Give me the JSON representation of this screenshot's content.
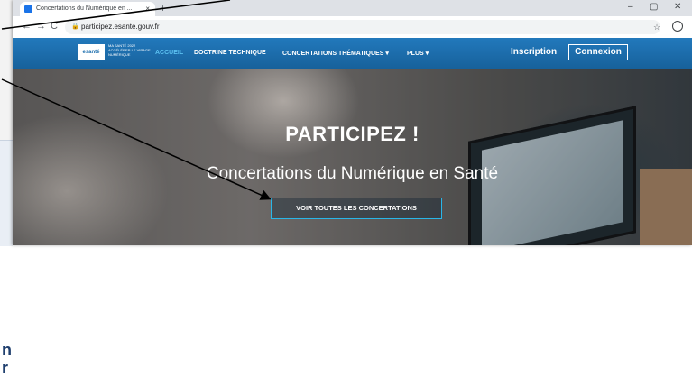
{
  "browser": {
    "tab_title": "Concertations du Numérique en ...",
    "tab_close": "×",
    "new_tab": "+",
    "url": "participez.esante.gouv.fr",
    "window_controls": {
      "minimize": "–",
      "maximize": "▢",
      "close": "✕"
    },
    "nav": {
      "back": "←",
      "forward": "→",
      "reload": "C"
    },
    "star": "☆"
  },
  "site": {
    "logo": "esanté",
    "logo_tagline": "MA SANTÉ 2022 ACCÉLÉRER LE VIRAGE NUMÉRIQUE",
    "menu": [
      "ACCUEIL",
      "DOCTRINE TECHNIQUE",
      "CONCERTATIONS THÉMATIQUES ▾",
      "PLUS ▾"
    ],
    "inscription": "Inscription",
    "connexion": "Connexion",
    "hero_title": "PARTICIPEZ !",
    "hero_subtitle": "Concertations du Numérique en Santé",
    "cta": "VOIR TOUTES LES CONCERTATIONS"
  },
  "document": {
    "fragment": "n\nr"
  },
  "colors": {
    "header_blue": "#1d6fae",
    "active_menu": "#5bc0f0",
    "cta_border": "#29b6e8"
  }
}
